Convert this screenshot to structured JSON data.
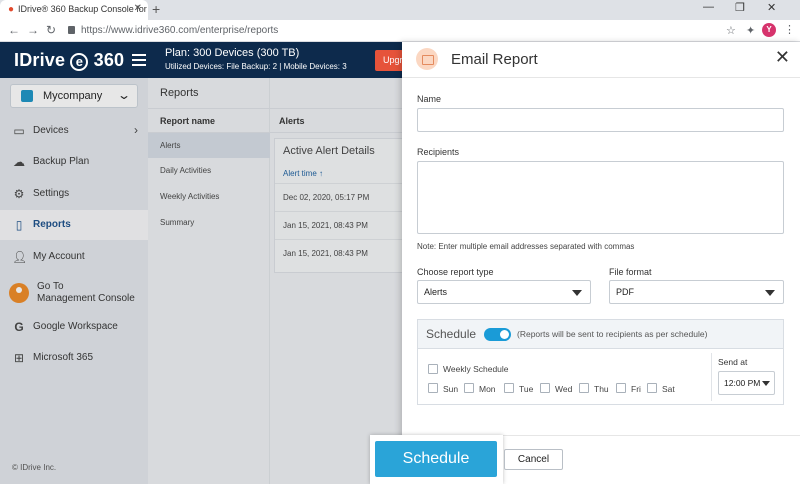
{
  "browser": {
    "tab_title": "IDrive® 360 Backup Console for",
    "url": "https://www.idrive360.com/enterprise/reports",
    "profile_initial": "Y"
  },
  "header": {
    "logo_text": "IDrive",
    "logo_e": "e",
    "logo_suffix": "360",
    "plan": "Plan: 300 Devices (300 TB)",
    "plan_sub": "Utilized Devices: File Backup: 2 | Mobile Devices: 3",
    "upgrade_label": "Upgrade"
  },
  "sidebar": {
    "company": "Mycompany",
    "items": [
      {
        "label": "Devices",
        "icon": "laptop-icon"
      },
      {
        "label": "Backup Plan",
        "icon": "cloud-upload-icon"
      },
      {
        "label": "Settings",
        "icon": "gear-icon"
      },
      {
        "label": "Reports",
        "icon": "document-icon"
      },
      {
        "label": "My Account",
        "icon": "user-icon"
      },
      {
        "label": "Go To",
        "label2": "Management Console",
        "icon": "avatar-icon"
      },
      {
        "label": "Google Workspace",
        "icon": "google-icon"
      },
      {
        "label": "Microsoft 365",
        "icon": "windows-icon"
      }
    ],
    "copyright": "© IDrive Inc."
  },
  "reports": {
    "title": "Reports",
    "column": "Report name",
    "items": [
      "Alerts",
      "Daily Activities",
      "Weekly Activities",
      "Summary"
    ]
  },
  "alerts": {
    "header": "Alerts",
    "card_title": "Active Alert Details",
    "column": "Alert time",
    "rows": [
      "Dec 02, 2020, 05:17 PM",
      "Jan 15, 2021, 08:43 PM",
      "Jan 15, 2021, 08:43 PM"
    ]
  },
  "modal": {
    "title": "Email Report",
    "name_label": "Name",
    "name_value": "",
    "recipients_label": "Recipients",
    "recipients_value": "",
    "note": "Note: Enter multiple email addresses separated with commas",
    "report_type_label": "Choose report type",
    "report_type_value": "Alerts",
    "file_format_label": "File format",
    "file_format_value": "PDF",
    "schedule_title": "Schedule",
    "schedule_note": "(Reports will be sent to recipients as per schedule)",
    "weekly_label": "Weekly Schedule",
    "days": [
      "Sun",
      "Mon",
      "Tue",
      "Wed",
      "Thu",
      "Fri",
      "Sat"
    ],
    "send_at_label": "Send at",
    "send_at_value": "12:00 PM",
    "schedule_button": "Schedule",
    "cancel_button": "Cancel"
  },
  "colors": {
    "header_bg": "#0d2a4c",
    "accent": "#2aa4d8",
    "upgrade": "#e6533a"
  }
}
